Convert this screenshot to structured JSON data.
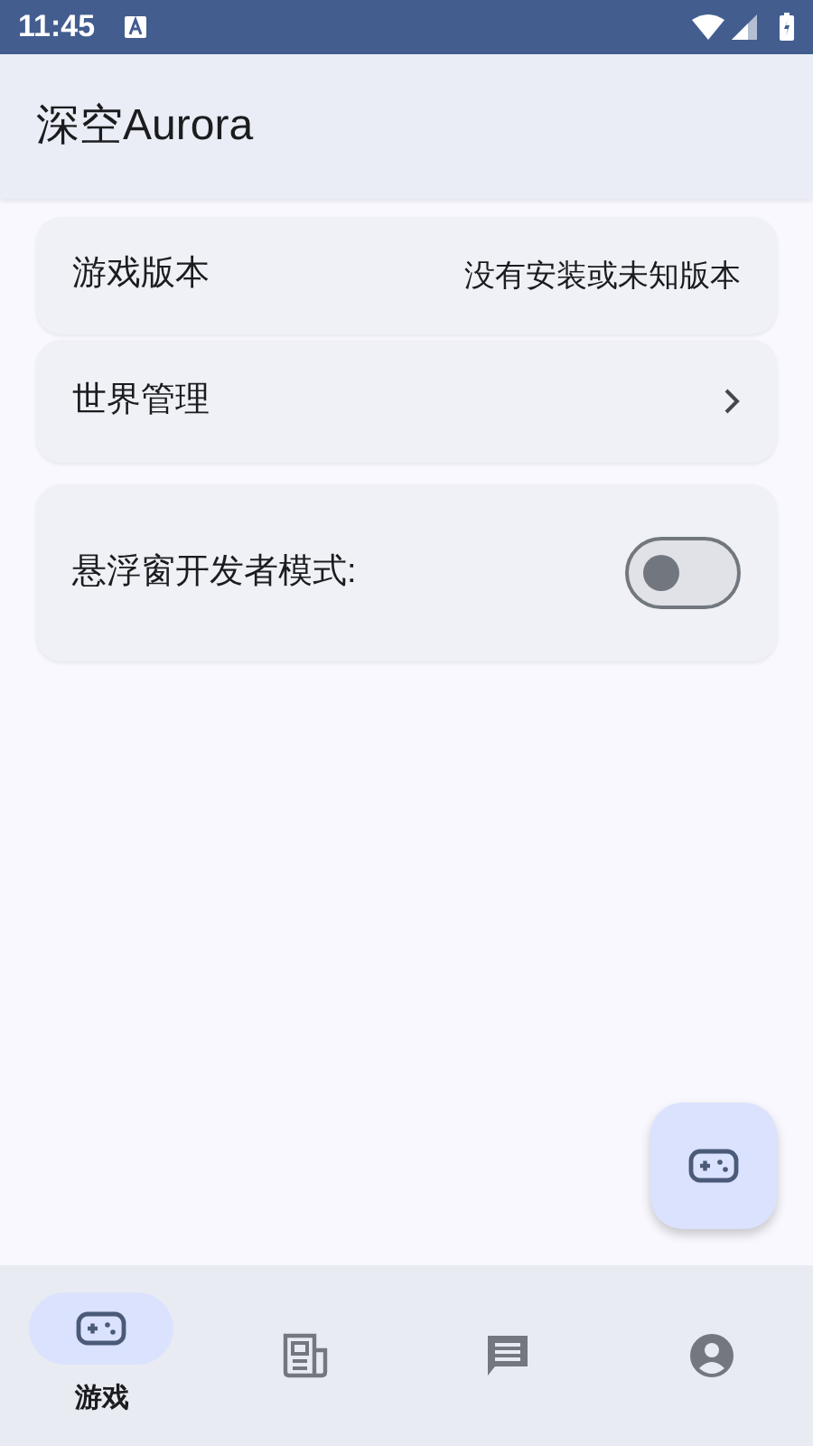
{
  "status_bar": {
    "time": "11:45"
  },
  "app_bar": {
    "title": "深空Aurora"
  },
  "settings": [
    {
      "kind": "value",
      "label": "游戏版本",
      "value": "没有安装或未知版本"
    },
    {
      "kind": "link",
      "label": "世界管理"
    },
    {
      "kind": "switch",
      "label": "悬浮窗开发者模式:",
      "on": false
    }
  ],
  "bottom_nav": [
    {
      "kind": "gamepad",
      "label": "游戏",
      "selected": true
    },
    {
      "kind": "news",
      "selected": false
    },
    {
      "kind": "chat",
      "selected": false
    },
    {
      "kind": "account",
      "selected": false
    }
  ]
}
